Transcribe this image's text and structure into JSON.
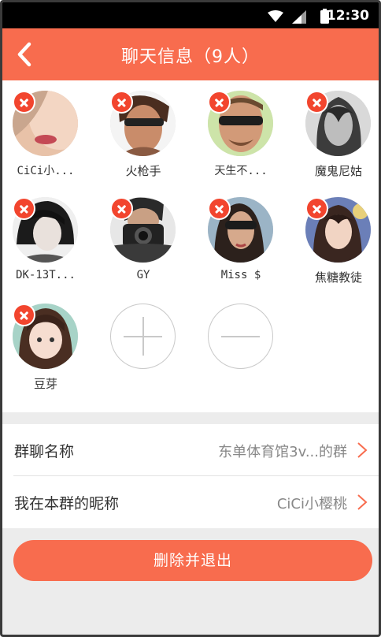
{
  "status_bar": {
    "time": "12:30"
  },
  "header": {
    "title": "聊天信息（9人）"
  },
  "members": [
    {
      "name": "CiCi小..."
    },
    {
      "name": "火枪手"
    },
    {
      "name": "天生不..."
    },
    {
      "name": "魔鬼尼姑"
    },
    {
      "name": "DK-13T..."
    },
    {
      "name": "GY"
    },
    {
      "name": "Miss $"
    },
    {
      "name": "焦糖教徒"
    },
    {
      "name": "豆芽"
    }
  ],
  "settings": {
    "group_name": {
      "label": "群聊名称",
      "value": "东单体育馆3v...的群"
    },
    "nickname": {
      "label": "我在本群的昵称",
      "value": "CiCi小樱桃"
    }
  },
  "exit_button": {
    "label": "删除并退出"
  },
  "colors": {
    "accent": "#f86c4e",
    "remove": "#f2452e"
  }
}
